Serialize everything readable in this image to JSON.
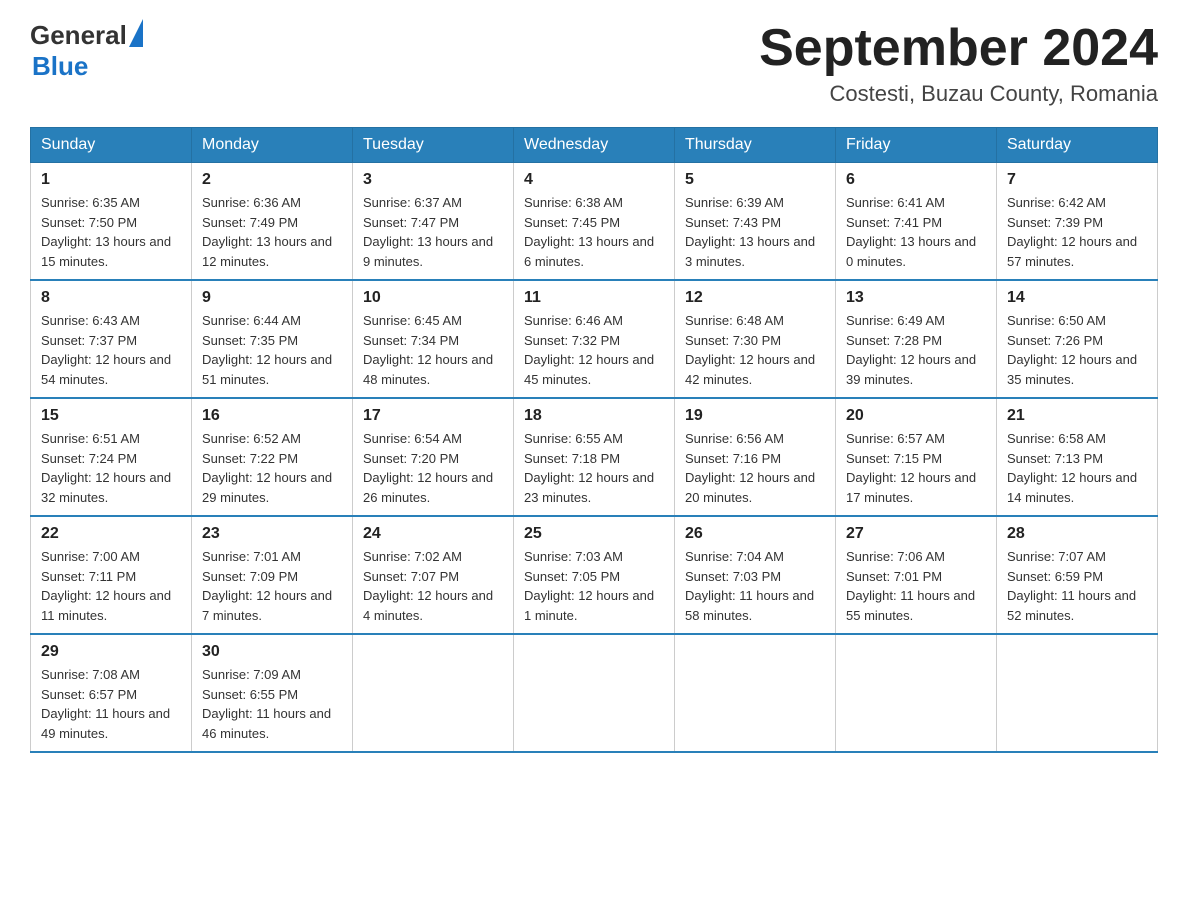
{
  "header": {
    "logo_general": "General",
    "logo_blue": "Blue",
    "month_year": "September 2024",
    "location": "Costesti, Buzau County, Romania"
  },
  "weekdays": [
    "Sunday",
    "Monday",
    "Tuesday",
    "Wednesday",
    "Thursday",
    "Friday",
    "Saturday"
  ],
  "weeks": [
    [
      {
        "day": "1",
        "sunrise": "6:35 AM",
        "sunset": "7:50 PM",
        "daylight": "13 hours and 15 minutes."
      },
      {
        "day": "2",
        "sunrise": "6:36 AM",
        "sunset": "7:49 PM",
        "daylight": "13 hours and 12 minutes."
      },
      {
        "day": "3",
        "sunrise": "6:37 AM",
        "sunset": "7:47 PM",
        "daylight": "13 hours and 9 minutes."
      },
      {
        "day": "4",
        "sunrise": "6:38 AM",
        "sunset": "7:45 PM",
        "daylight": "13 hours and 6 minutes."
      },
      {
        "day": "5",
        "sunrise": "6:39 AM",
        "sunset": "7:43 PM",
        "daylight": "13 hours and 3 minutes."
      },
      {
        "day": "6",
        "sunrise": "6:41 AM",
        "sunset": "7:41 PM",
        "daylight": "13 hours and 0 minutes."
      },
      {
        "day": "7",
        "sunrise": "6:42 AM",
        "sunset": "7:39 PM",
        "daylight": "12 hours and 57 minutes."
      }
    ],
    [
      {
        "day": "8",
        "sunrise": "6:43 AM",
        "sunset": "7:37 PM",
        "daylight": "12 hours and 54 minutes."
      },
      {
        "day": "9",
        "sunrise": "6:44 AM",
        "sunset": "7:35 PM",
        "daylight": "12 hours and 51 minutes."
      },
      {
        "day": "10",
        "sunrise": "6:45 AM",
        "sunset": "7:34 PM",
        "daylight": "12 hours and 48 minutes."
      },
      {
        "day": "11",
        "sunrise": "6:46 AM",
        "sunset": "7:32 PM",
        "daylight": "12 hours and 45 minutes."
      },
      {
        "day": "12",
        "sunrise": "6:48 AM",
        "sunset": "7:30 PM",
        "daylight": "12 hours and 42 minutes."
      },
      {
        "day": "13",
        "sunrise": "6:49 AM",
        "sunset": "7:28 PM",
        "daylight": "12 hours and 39 minutes."
      },
      {
        "day": "14",
        "sunrise": "6:50 AM",
        "sunset": "7:26 PM",
        "daylight": "12 hours and 35 minutes."
      }
    ],
    [
      {
        "day": "15",
        "sunrise": "6:51 AM",
        "sunset": "7:24 PM",
        "daylight": "12 hours and 32 minutes."
      },
      {
        "day": "16",
        "sunrise": "6:52 AM",
        "sunset": "7:22 PM",
        "daylight": "12 hours and 29 minutes."
      },
      {
        "day": "17",
        "sunrise": "6:54 AM",
        "sunset": "7:20 PM",
        "daylight": "12 hours and 26 minutes."
      },
      {
        "day": "18",
        "sunrise": "6:55 AM",
        "sunset": "7:18 PM",
        "daylight": "12 hours and 23 minutes."
      },
      {
        "day": "19",
        "sunrise": "6:56 AM",
        "sunset": "7:16 PM",
        "daylight": "12 hours and 20 minutes."
      },
      {
        "day": "20",
        "sunrise": "6:57 AM",
        "sunset": "7:15 PM",
        "daylight": "12 hours and 17 minutes."
      },
      {
        "day": "21",
        "sunrise": "6:58 AM",
        "sunset": "7:13 PM",
        "daylight": "12 hours and 14 minutes."
      }
    ],
    [
      {
        "day": "22",
        "sunrise": "7:00 AM",
        "sunset": "7:11 PM",
        "daylight": "12 hours and 11 minutes."
      },
      {
        "day": "23",
        "sunrise": "7:01 AM",
        "sunset": "7:09 PM",
        "daylight": "12 hours and 7 minutes."
      },
      {
        "day": "24",
        "sunrise": "7:02 AM",
        "sunset": "7:07 PM",
        "daylight": "12 hours and 4 minutes."
      },
      {
        "day": "25",
        "sunrise": "7:03 AM",
        "sunset": "7:05 PM",
        "daylight": "12 hours and 1 minute."
      },
      {
        "day": "26",
        "sunrise": "7:04 AM",
        "sunset": "7:03 PM",
        "daylight": "11 hours and 58 minutes."
      },
      {
        "day": "27",
        "sunrise": "7:06 AM",
        "sunset": "7:01 PM",
        "daylight": "11 hours and 55 minutes."
      },
      {
        "day": "28",
        "sunrise": "7:07 AM",
        "sunset": "6:59 PM",
        "daylight": "11 hours and 52 minutes."
      }
    ],
    [
      {
        "day": "29",
        "sunrise": "7:08 AM",
        "sunset": "6:57 PM",
        "daylight": "11 hours and 49 minutes."
      },
      {
        "day": "30",
        "sunrise": "7:09 AM",
        "sunset": "6:55 PM",
        "daylight": "11 hours and 46 minutes."
      },
      null,
      null,
      null,
      null,
      null
    ]
  ]
}
